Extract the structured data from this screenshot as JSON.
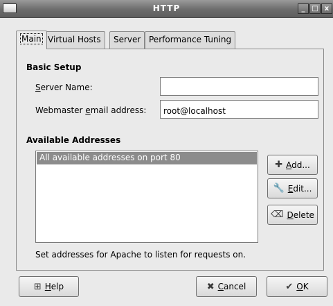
{
  "window": {
    "title": "HTTP"
  },
  "title_buttons": {
    "minimize": "_",
    "maximize": "□",
    "close": "x"
  },
  "tabs": [
    {
      "label": "Main",
      "active": true
    },
    {
      "label": "Virtual Hosts",
      "active": false
    },
    {
      "label": "Server",
      "active": false
    },
    {
      "label": "Performance Tuning",
      "active": false
    }
  ],
  "basic_setup": {
    "title": "Basic Setup",
    "server_name_label_u": "S",
    "server_name_label_rest": "erver Name:",
    "server_name_value": "",
    "webmaster_label_pre": "Webmaster ",
    "webmaster_label_u": "e",
    "webmaster_label_post": "mail address:",
    "webmaster_value": "root@localhost"
  },
  "addresses": {
    "title": "Available Addresses",
    "items": [
      "All available addresses on port 80"
    ],
    "add_u": "A",
    "add_rest": "dd...",
    "edit_u": "E",
    "edit_rest": "dit...",
    "delete_u": "D",
    "delete_rest": "elete",
    "hint": "Set addresses for Apache to listen for requests on."
  },
  "footer": {
    "help_u": "H",
    "help_rest": "elp",
    "cancel_u": "C",
    "cancel_rest": "ancel",
    "ok_u": "O",
    "ok_rest": "K"
  },
  "icons": {
    "help": "help-icon",
    "add": "plus-icon",
    "edit": "wrench-icon",
    "delete": "trash-icon",
    "cancel": "x-icon",
    "ok": "check-icon"
  }
}
